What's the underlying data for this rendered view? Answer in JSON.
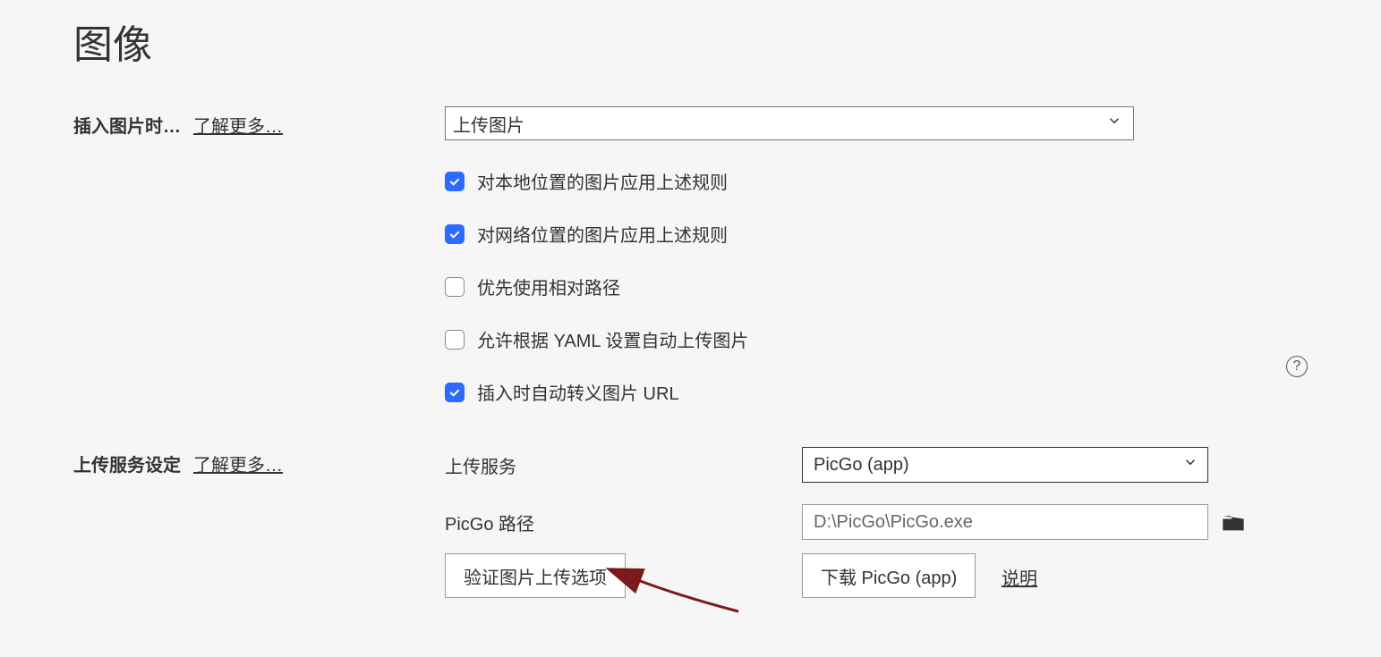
{
  "title": "图像",
  "insertImage": {
    "label": "插入图片时…",
    "learnMore": "了解更多…",
    "selected": "上传图片",
    "checkboxes": [
      {
        "checked": true,
        "label": "对本地位置的图片应用上述规则"
      },
      {
        "checked": true,
        "label": "对网络位置的图片应用上述规则"
      },
      {
        "checked": false,
        "label": "优先使用相对路径"
      },
      {
        "checked": false,
        "label": "允许根据 YAML 设置自动上传图片"
      },
      {
        "checked": true,
        "label": "插入时自动转义图片 URL"
      }
    ]
  },
  "uploadService": {
    "label": "上传服务设定",
    "learnMore": "了解更多…",
    "serviceLabel": "上传服务",
    "serviceSelected": "PicGo (app)",
    "pathLabel": "PicGo 路径",
    "pathValue": "D:\\PicGo\\PicGo.exe",
    "verifyBtn": "验证图片上传选项",
    "downloadBtn": "下载 PicGo (app)",
    "descLink": "说明"
  }
}
